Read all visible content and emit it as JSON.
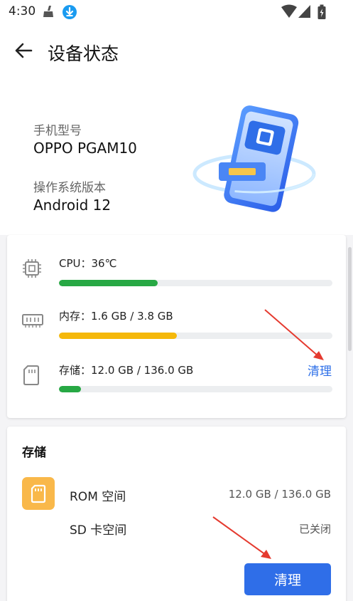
{
  "status_bar": {
    "time": "4:30"
  },
  "header": {
    "title": "设备状态"
  },
  "device": {
    "model_label": "手机型号",
    "model_value": "OPPO PGAM10",
    "os_label": "操作系统版本",
    "os_value": "Android 12"
  },
  "resources": {
    "cpu": {
      "text": "CPU：36℃",
      "progress": 0.36,
      "color": "#27a844"
    },
    "memory": {
      "text": "内存：1.6 GB / 3.8 GB",
      "progress": 0.43,
      "color": "#f5b80a"
    },
    "storage": {
      "text": "存储：12.0 GB / 136.0 GB",
      "progress": 0.08,
      "color": "#27a844"
    },
    "clean_label": "清理"
  },
  "storage_card": {
    "title": "存储",
    "rom_label": "ROM 空间",
    "rom_value": "12.0 GB / 136.0 GB",
    "sd_label": "SD 卡空间",
    "sd_value": "已关闭",
    "clean_button": "清理"
  },
  "icons": {
    "back": "arrow-left-icon",
    "cpu": "chip-icon",
    "memory": "ram-icon",
    "storage": "sd-card-icon",
    "rom": "sd-card-icon"
  }
}
